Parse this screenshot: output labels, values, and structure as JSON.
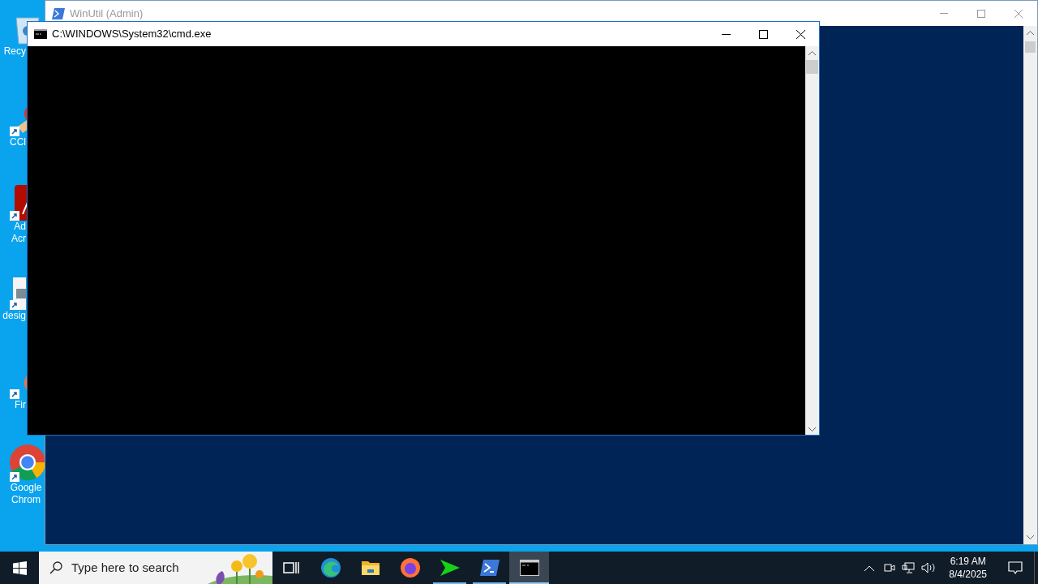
{
  "desktop_icons": [
    {
      "kind": "recycle",
      "lines": [
        "Recy"
      ]
    },
    {
      "kind": "ccleaner",
      "lines": [
        "CCl"
      ]
    },
    {
      "kind": "acrobat",
      "lines": [
        "Ad",
        "Acr"
      ]
    },
    {
      "kind": "image",
      "lines": [
        "desig"
      ]
    },
    {
      "kind": "firefox",
      "lines": [
        "Fir"
      ]
    },
    {
      "kind": "chrome",
      "lines": [
        "Google",
        "Chrom"
      ]
    }
  ],
  "background_window": {
    "title": "WinUtil (Admin)",
    "active": false
  },
  "console_window": {
    "title": "C:\\WINDOWS\\System32\\cmd.exe",
    "active": true
  },
  "taskbar": {
    "search": {
      "placeholder": "Type here to search"
    },
    "apps": [
      {
        "kind": "taskview",
        "running": false,
        "selected": false
      },
      {
        "kind": "edge",
        "running": false,
        "selected": false
      },
      {
        "kind": "explorer",
        "running": false,
        "selected": false
      },
      {
        "kind": "firefox",
        "running": false,
        "selected": false
      },
      {
        "kind": "arrow",
        "running": true,
        "selected": false
      },
      {
        "kind": "powershell",
        "running": true,
        "selected": false
      },
      {
        "kind": "cmd",
        "running": true,
        "selected": true
      }
    ],
    "time": "6:19 AM",
    "date": "8/4/2025"
  }
}
